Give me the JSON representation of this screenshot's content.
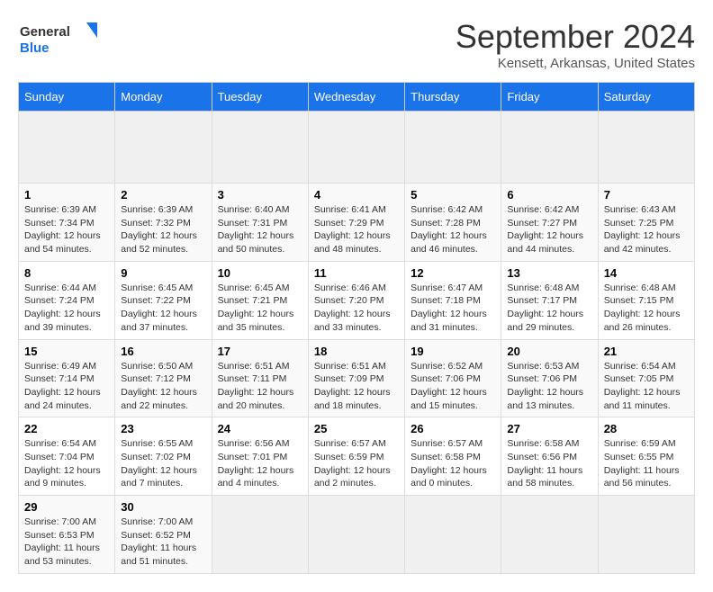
{
  "header": {
    "logo_general": "General",
    "logo_blue": "Blue",
    "month_title": "September 2024",
    "location": "Kensett, Arkansas, United States"
  },
  "calendar": {
    "days_of_week": [
      "Sunday",
      "Monday",
      "Tuesday",
      "Wednesday",
      "Thursday",
      "Friday",
      "Saturday"
    ],
    "weeks": [
      [
        {
          "day": "",
          "empty": true
        },
        {
          "day": "",
          "empty": true
        },
        {
          "day": "",
          "empty": true
        },
        {
          "day": "",
          "empty": true
        },
        {
          "day": "",
          "empty": true
        },
        {
          "day": "",
          "empty": true
        },
        {
          "day": "",
          "empty": true
        }
      ],
      [
        {
          "day": "1",
          "sunrise": "6:39 AM",
          "sunset": "7:34 PM",
          "daylight": "12 hours and 54 minutes."
        },
        {
          "day": "2",
          "sunrise": "6:39 AM",
          "sunset": "7:32 PM",
          "daylight": "12 hours and 52 minutes."
        },
        {
          "day": "3",
          "sunrise": "6:40 AM",
          "sunset": "7:31 PM",
          "daylight": "12 hours and 50 minutes."
        },
        {
          "day": "4",
          "sunrise": "6:41 AM",
          "sunset": "7:29 PM",
          "daylight": "12 hours and 48 minutes."
        },
        {
          "day": "5",
          "sunrise": "6:42 AM",
          "sunset": "7:28 PM",
          "daylight": "12 hours and 46 minutes."
        },
        {
          "day": "6",
          "sunrise": "6:42 AM",
          "sunset": "7:27 PM",
          "daylight": "12 hours and 44 minutes."
        },
        {
          "day": "7",
          "sunrise": "6:43 AM",
          "sunset": "7:25 PM",
          "daylight": "12 hours and 42 minutes."
        }
      ],
      [
        {
          "day": "8",
          "sunrise": "6:44 AM",
          "sunset": "7:24 PM",
          "daylight": "12 hours and 39 minutes."
        },
        {
          "day": "9",
          "sunrise": "6:45 AM",
          "sunset": "7:22 PM",
          "daylight": "12 hours and 37 minutes."
        },
        {
          "day": "10",
          "sunrise": "6:45 AM",
          "sunset": "7:21 PM",
          "daylight": "12 hours and 35 minutes."
        },
        {
          "day": "11",
          "sunrise": "6:46 AM",
          "sunset": "7:20 PM",
          "daylight": "12 hours and 33 minutes."
        },
        {
          "day": "12",
          "sunrise": "6:47 AM",
          "sunset": "7:18 PM",
          "daylight": "12 hours and 31 minutes."
        },
        {
          "day": "13",
          "sunrise": "6:48 AM",
          "sunset": "7:17 PM",
          "daylight": "12 hours and 29 minutes."
        },
        {
          "day": "14",
          "sunrise": "6:48 AM",
          "sunset": "7:15 PM",
          "daylight": "12 hours and 26 minutes."
        }
      ],
      [
        {
          "day": "15",
          "sunrise": "6:49 AM",
          "sunset": "7:14 PM",
          "daylight": "12 hours and 24 minutes."
        },
        {
          "day": "16",
          "sunrise": "6:50 AM",
          "sunset": "7:12 PM",
          "daylight": "12 hours and 22 minutes."
        },
        {
          "day": "17",
          "sunrise": "6:51 AM",
          "sunset": "7:11 PM",
          "daylight": "12 hours and 20 minutes."
        },
        {
          "day": "18",
          "sunrise": "6:51 AM",
          "sunset": "7:09 PM",
          "daylight": "12 hours and 18 minutes."
        },
        {
          "day": "19",
          "sunrise": "6:52 AM",
          "sunset": "7:06 PM",
          "daylight": "12 hours and 15 minutes."
        },
        {
          "day": "20",
          "sunrise": "6:53 AM",
          "sunset": "7:06 PM",
          "daylight": "12 hours and 13 minutes."
        },
        {
          "day": "21",
          "sunrise": "6:54 AM",
          "sunset": "7:05 PM",
          "daylight": "12 hours and 11 minutes."
        }
      ],
      [
        {
          "day": "22",
          "sunrise": "6:54 AM",
          "sunset": "7:04 PM",
          "daylight": "12 hours and 9 minutes."
        },
        {
          "day": "23",
          "sunrise": "6:55 AM",
          "sunset": "7:02 PM",
          "daylight": "12 hours and 7 minutes."
        },
        {
          "day": "24",
          "sunrise": "6:56 AM",
          "sunset": "7:01 PM",
          "daylight": "12 hours and 4 minutes."
        },
        {
          "day": "25",
          "sunrise": "6:57 AM",
          "sunset": "6:59 PM",
          "daylight": "12 hours and 2 minutes."
        },
        {
          "day": "26",
          "sunrise": "6:57 AM",
          "sunset": "6:58 PM",
          "daylight": "12 hours and 0 minutes."
        },
        {
          "day": "27",
          "sunrise": "6:58 AM",
          "sunset": "6:56 PM",
          "daylight": "11 hours and 58 minutes."
        },
        {
          "day": "28",
          "sunrise": "6:59 AM",
          "sunset": "6:55 PM",
          "daylight": "11 hours and 56 minutes."
        }
      ],
      [
        {
          "day": "29",
          "sunrise": "7:00 AM",
          "sunset": "6:53 PM",
          "daylight": "11 hours and 53 minutes."
        },
        {
          "day": "30",
          "sunrise": "7:00 AM",
          "sunset": "6:52 PM",
          "daylight": "11 hours and 51 minutes."
        },
        {
          "day": "",
          "empty": true
        },
        {
          "day": "",
          "empty": true
        },
        {
          "day": "",
          "empty": true
        },
        {
          "day": "",
          "empty": true
        },
        {
          "day": "",
          "empty": true
        }
      ]
    ]
  }
}
